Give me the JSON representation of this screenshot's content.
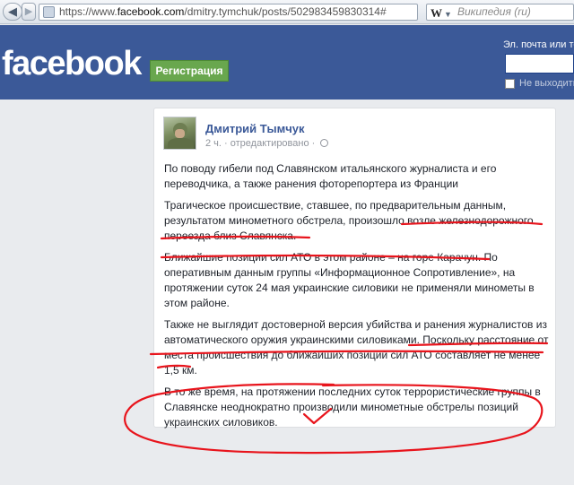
{
  "browser": {
    "back_icon": "arrow-left-icon",
    "forward_icon": "arrow-right-icon",
    "url_scheme": "https://www.",
    "url_host": "facebook.com",
    "url_path": "/dmitry.tymchuk/posts/502983459830314#",
    "search_placeholder": "Википедия (ru)",
    "search_engine_icon": "W"
  },
  "header": {
    "logo": "facebook",
    "register_label": "Регистрация",
    "email_label": "Эл. почта или те",
    "keep_logged_label": "Не выходить"
  },
  "post": {
    "author": "Дмитрий Тымчук",
    "time": "2 ч.",
    "edited": "· отредактировано ·",
    "paragraphs": [
      "По поводу гибели под Славянском итальянского журналиста и его переводчика, а также ранения фоторепортера из Франции",
      "Трагическое происшествие, ставшее, по предварительным данным, результатом минометного обстрела, произошло возле железнодорожного переезда близ Славянска.",
      "Ближайшие позиции сил АТО в этом районе – на горе Карачун. По оперативным данным группы «Информационное Сопротивление», на протяжении суток 24 мая украинские силовики не применяли минометы в этом районе.",
      "Также не выглядит достоверной версия убийства и ранения журналистов из автоматического оружия украинскими силовиками. Поскольку расстояние от места происшествия до ближайших позиций сил АТО составляет не менее 1,5 км.",
      "В то же время, на протяжении последних суток террористические группы в Славянске неоднократно производили минометные обстрелы позиций украинских силовиков."
    ]
  },
  "colors": {
    "facebook_blue": "#3b5998",
    "register_green": "#69a74e",
    "annotation_red": "#e8141c"
  }
}
